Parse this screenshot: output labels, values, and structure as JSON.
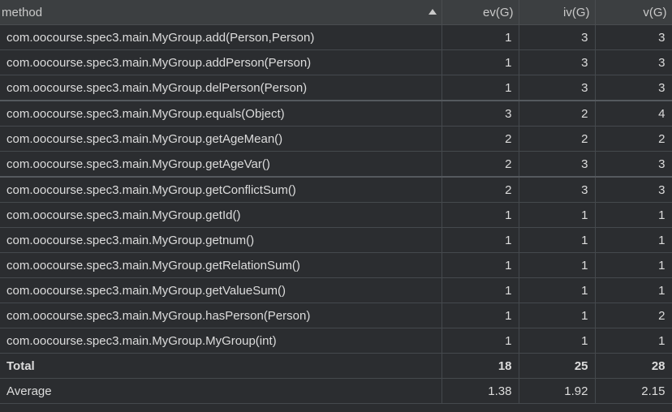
{
  "columns": [
    "method",
    "ev(G)",
    "iv(G)",
    "v(G)"
  ],
  "rows": [
    {
      "method": "com.oocourse.spec3.main.MyGroup.add(Person,Person)",
      "ev": "1",
      "iv": "3",
      "v": "3"
    },
    {
      "method": "com.oocourse.spec3.main.MyGroup.addPerson(Person)",
      "ev": "1",
      "iv": "3",
      "v": "3"
    },
    {
      "method": "com.oocourse.spec3.main.MyGroup.delPerson(Person)",
      "ev": "1",
      "iv": "3",
      "v": "3"
    },
    {
      "method": "com.oocourse.spec3.main.MyGroup.equals(Object)",
      "ev": "3",
      "iv": "2",
      "v": "4"
    },
    {
      "method": "com.oocourse.spec3.main.MyGroup.getAgeMean()",
      "ev": "2",
      "iv": "2",
      "v": "2"
    },
    {
      "method": "com.oocourse.spec3.main.MyGroup.getAgeVar()",
      "ev": "2",
      "iv": "3",
      "v": "3"
    },
    {
      "method": "com.oocourse.spec3.main.MyGroup.getConflictSum()",
      "ev": "2",
      "iv": "3",
      "v": "3"
    },
    {
      "method": "com.oocourse.spec3.main.MyGroup.getId()",
      "ev": "1",
      "iv": "1",
      "v": "1"
    },
    {
      "method": "com.oocourse.spec3.main.MyGroup.getnum()",
      "ev": "1",
      "iv": "1",
      "v": "1"
    },
    {
      "method": "com.oocourse.spec3.main.MyGroup.getRelationSum()",
      "ev": "1",
      "iv": "1",
      "v": "1"
    },
    {
      "method": "com.oocourse.spec3.main.MyGroup.getValueSum()",
      "ev": "1",
      "iv": "1",
      "v": "1"
    },
    {
      "method": "com.oocourse.spec3.main.MyGroup.hasPerson(Person)",
      "ev": "1",
      "iv": "1",
      "v": "2"
    },
    {
      "method": "com.oocourse.spec3.main.MyGroup.MyGroup(int)",
      "ev": "1",
      "iv": "1",
      "v": "1"
    }
  ],
  "total": {
    "label": "Total",
    "ev": "18",
    "iv": "25",
    "v": "28"
  },
  "average": {
    "label": "Average",
    "ev": "1.38",
    "iv": "1.92",
    "v": "2.15"
  },
  "sort": {
    "column": "method",
    "direction": "ascending",
    "icon": "sort-ascending-icon"
  }
}
